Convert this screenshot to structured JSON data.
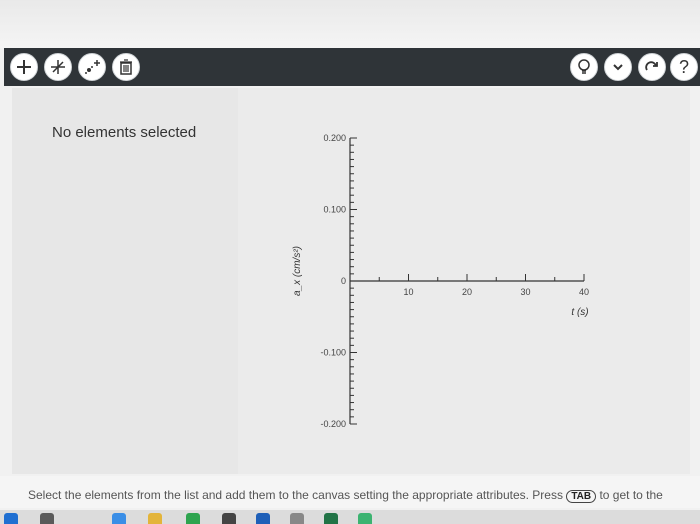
{
  "toolbar": {
    "left_tools": [
      "add-icon",
      "axis-tool-icon",
      "add-point-icon",
      "trash-icon"
    ],
    "right_tools": [
      "lightbulb-icon",
      "chevron-down-icon",
      "redo-icon",
      "help-icon"
    ],
    "help_label": "?"
  },
  "panel": {
    "status": "No elements selected"
  },
  "chart_data": {
    "type": "line",
    "series": [],
    "xlabel": "t (s)",
    "ylabel": "a_x (cm/s²)",
    "xlim": [
      0,
      40
    ],
    "ylim": [
      -0.2,
      0.2
    ],
    "x_ticks": [
      "10",
      "20",
      "30",
      "40"
    ],
    "y_ticks": [
      "0.200",
      "0.100",
      "0",
      "-0.100",
      "-0.200"
    ]
  },
  "instructions": {
    "before": "Select the elements from the list and add them to the canvas setting the appropriate attributes. Press",
    "key": "TAB",
    "after": "to get to the"
  },
  "colors": {
    "toolbar_bg": "#2f3438",
    "canvas_bg": "#ebebeb",
    "taskbar": "#dcdcdc"
  }
}
